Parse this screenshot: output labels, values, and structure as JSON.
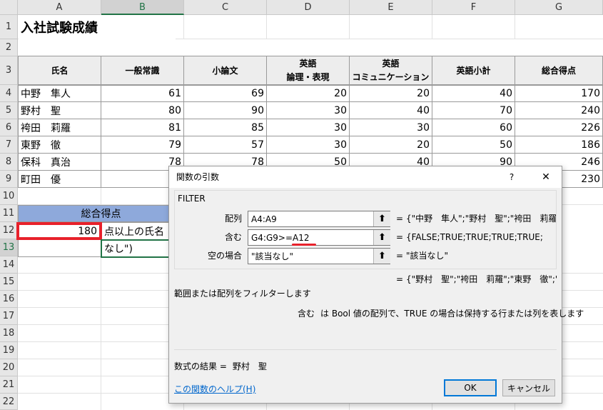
{
  "columns": [
    "A",
    "B",
    "C",
    "D",
    "E",
    "F",
    "G"
  ],
  "rows": [
    "1",
    "2",
    "3",
    "4",
    "5",
    "6",
    "7",
    "8",
    "9",
    "10",
    "11",
    "12",
    "13",
    "14",
    "15",
    "16",
    "17",
    "18",
    "19",
    "20",
    "21",
    "22"
  ],
  "sheet": {
    "title": "入社試験成績",
    "headers": {
      "name": "氏名",
      "general": "一般常識",
      "essay": "小論文",
      "eng_logic_1": "英語",
      "eng_logic_2": "論理・表現",
      "eng_comm_1": "英語",
      "eng_comm_2": "コミュニケーション",
      "eng_sub": "英語小計",
      "total": "総合得点"
    },
    "data": [
      [
        "中野　隼人",
        "61",
        "69",
        "20",
        "20",
        "40",
        "170"
      ],
      [
        "野村　聖",
        "80",
        "90",
        "30",
        "40",
        "70",
        "240"
      ],
      [
        "袴田　莉羅",
        "81",
        "85",
        "30",
        "30",
        "60",
        "226"
      ],
      [
        "東野　徹",
        "79",
        "57",
        "30",
        "20",
        "50",
        "186"
      ],
      [
        "保科　真治",
        "78",
        "78",
        "50",
        "40",
        "90",
        "246"
      ],
      [
        "町田　優",
        "",
        "",
        "",
        "",
        "",
        "230"
      ]
    ],
    "criteria_header": "総合得点",
    "criteria_value": "180",
    "criteria_label": "点以上の氏名",
    "b13_text": "なし\")"
  },
  "dialog": {
    "title": "関数の引数",
    "help_glyph": "?",
    "close_glyph": "✕",
    "function_name": "FILTER",
    "args": [
      {
        "label": "配列",
        "value": "A4:A9",
        "result": "{\"中野　隼人\";\"野村　聖\";\"袴田　莉羅"
      },
      {
        "label": "含む",
        "value": "G4:G9>=A12",
        "result": "{FALSE;TRUE;TRUE;TRUE;TRUE;"
      },
      {
        "label": "空の場合",
        "value": "\"該当なし\"",
        "result": "\"該当なし\""
      }
    ],
    "equals": "=",
    "overall_result": "{\"野村　聖\";\"袴田　莉羅\";\"東野　徹\";'",
    "description": "範囲または配列をフィルターします",
    "arg_help_name": "含む",
    "arg_help_text": "は Bool 値の配列で、TRUE の場合は保持する行または列を表します",
    "formula_result_label": "数式の結果 =",
    "formula_result_value": "野村　聖",
    "help_link": "この関数のヘルプ(H)",
    "ok_label": "OK",
    "cancel_label": "キャンセル",
    "ref_glyph": "⬆"
  },
  "colors": {
    "accent_green": "#217346",
    "highlight_red": "#e8212b",
    "criteria_blue": "#8ea9db"
  }
}
